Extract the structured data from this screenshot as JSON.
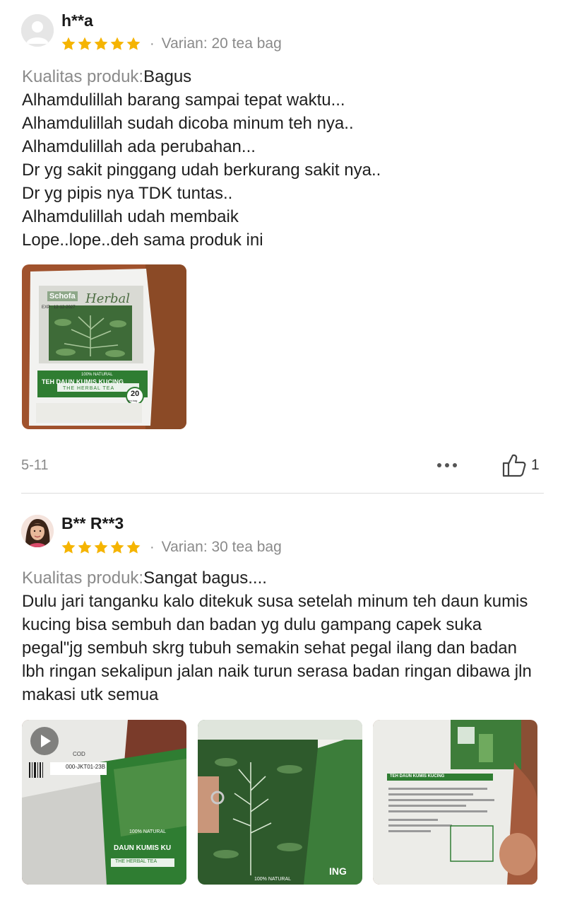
{
  "reviews": [
    {
      "username": "h**a",
      "rating": 5,
      "variant": "Varian: 20 tea bag",
      "quality_label": "Kualitas produk:",
      "quality_value": "Bagus",
      "text_lines": [
        "Alhamdulillah barang sampai tepat waktu...",
        "Alhamdulillah sudah dicoba minum teh nya..",
        "Alhamdulillah ada perubahan...",
        "Dr yg sakit pinggang udah berkurang sakit nya..",
        "Dr yg pipis nya TDK tuntas..",
        "Alhamdulillah udah membaik",
        "Lope..lope..deh sama produk ini"
      ],
      "photo": {
        "top_brand": "Schofa",
        "brand_script": "Herbal",
        "exp": "EXP : 12-12-2027",
        "natural": "100% NATURAL",
        "product": "TEH DAUN KUMIS KUCING",
        "subtitle": "THE HERBAL TEA",
        "count": "20",
        "count_unit": "tea bag"
      },
      "date": "5-11",
      "likes": "1"
    },
    {
      "username": "B** R**3",
      "rating": 5,
      "variant": "Varian: 30 tea bag",
      "quality_label": "Kualitas produk:",
      "quality_value": "Sangat bagus....",
      "text": "Dulu jari tanganku kalo ditekuk susa setelah minum teh daun kumis kucing bisa sembuh dan badan yg dulu gampang capek suka pegal\"jg sembuh skrg tubuh semakin sehat pegal ilang dan badan lbh ringan sekalipun jalan naik turun serasa badan ringan dibawa jln makasi utk semua",
      "photos": [
        {
          "label1": "COD",
          "label2": "000-JKT01-23B",
          "natural": "100% NATURAL",
          "product": "DAUN KUMIS KU",
          "subtitle": "THE HERBAL TEA"
        },
        {
          "natural": "100% NATURAL",
          "product": "ING"
        },
        {
          "header": "TEH DAUN KUMIS KUCING"
        }
      ]
    }
  ],
  "colors": {
    "star": "#f5b400",
    "muted_text": "#8a8a8a",
    "product_green": "#2f7d32"
  }
}
